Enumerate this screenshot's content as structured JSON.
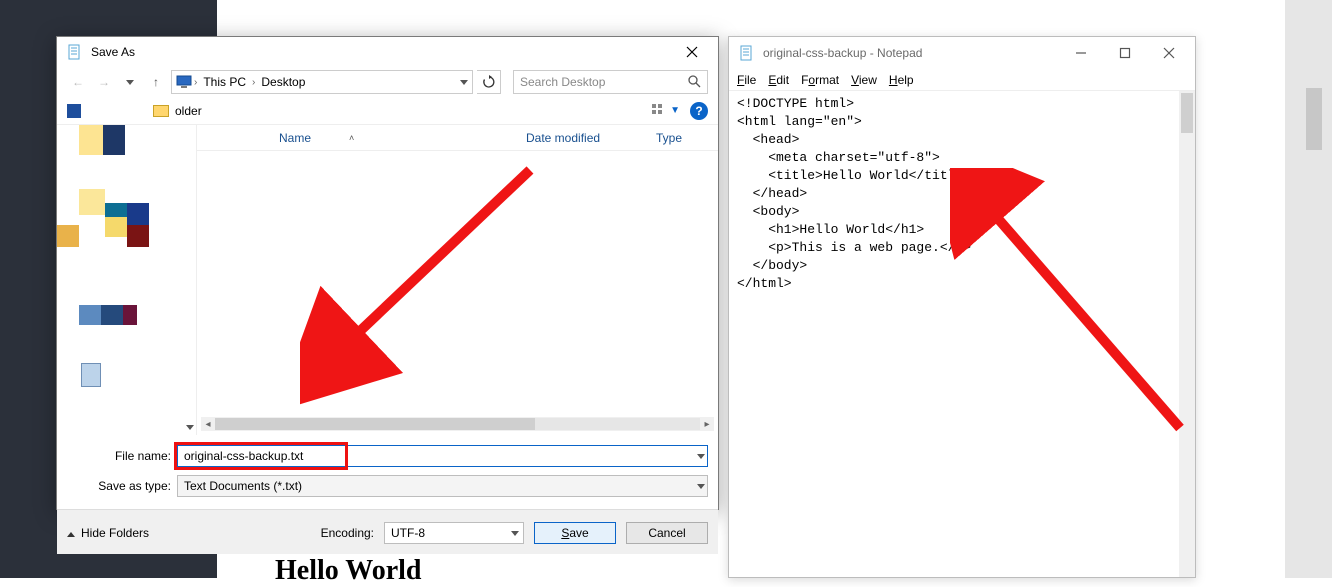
{
  "background": {
    "hello_heading": "Hello World"
  },
  "saveas": {
    "title": "Save As",
    "nav": {
      "pc": "This PC",
      "loc": "Desktop",
      "dropdown_caret": "▾"
    },
    "search": {
      "placeholder": "Search Desktop"
    },
    "toolbar": {
      "folder_text": "older"
    },
    "columns": {
      "name": "Name",
      "modified": "Date modified",
      "type": "Type"
    },
    "filename_label": "File name:",
    "filename_value": "original-css-backup.txt",
    "savetype_label": "Save as type:",
    "savetype_value": "Text Documents (*.txt)",
    "hide_folders": "Hide Folders",
    "encoding_label": "Encoding:",
    "encoding_value": "UTF-8",
    "save_btn": "Save",
    "cancel_btn": "Cancel"
  },
  "notepad": {
    "title": "original-css-backup - Notepad",
    "menu": {
      "file": "File",
      "edit": "Edit",
      "format": "Format",
      "view": "View",
      "help": "Help"
    },
    "content": "<!DOCTYPE html>\n<html lang=\"en\">\n  <head>\n    <meta charset=\"utf-8\">\n    <title>Hello World</title>\n  </head>\n  <body>\n    <h1>Hello World</h1>\n    <p>This is a web page.</p>\n  </body>\n</html>"
  }
}
